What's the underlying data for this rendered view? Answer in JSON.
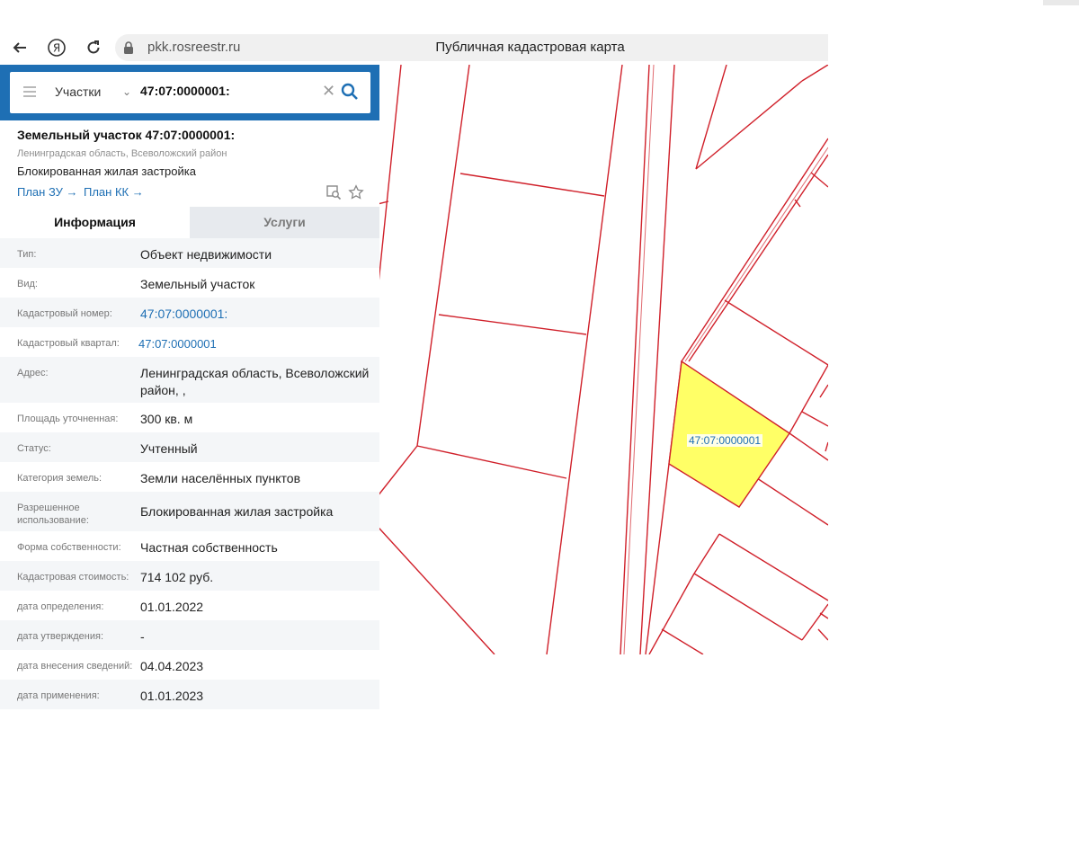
{
  "browser": {
    "url": "pkk.rosreestr.ru",
    "title": "Публичная кадастровая карта",
    "back_icon": "arrow-left-icon",
    "home_icon": "yandex-icon",
    "reload_icon": "reload-icon"
  },
  "search": {
    "type": "Участки",
    "value": "47:07:0000001:"
  },
  "object": {
    "title": "Земельный участок 47:07:0000001:",
    "region": "Ленинградская область, Всеволожский район",
    "purpose": "Блокированная жилая застройка",
    "link_plan_zu": "План ЗУ →",
    "link_plan_kk": "План КК →"
  },
  "tabs": {
    "info": "Информация",
    "services": "Услуги"
  },
  "rows": [
    {
      "label": "Тип:",
      "value": "Объект недвижимости"
    },
    {
      "label": "Вид:",
      "value": "Земельный участок"
    },
    {
      "label": "Кадастровый номер:",
      "value": "47:07:0000001:"
    },
    {
      "label": "Кадастровый квартал:",
      "value": "47:07:0000001"
    },
    {
      "label": "Адрес:",
      "value": "Ленинградская область, Всеволожский район, ,"
    },
    {
      "label": "Площадь уточненная:",
      "value": "300 кв. м"
    },
    {
      "label": "Статус:",
      "value": "Учтенный"
    },
    {
      "label": "Категория земель:",
      "value": "Земли населённых пунктов"
    },
    {
      "label": "Разрешенное использование:",
      "value": "Блокированная жилая застройка"
    },
    {
      "label": "Форма собственности:",
      "value": "Частная собственность"
    },
    {
      "label": "Кадастровая стоимость:",
      "value": "714 102 руб."
    },
    {
      "label": "дата определения:",
      "value": "01.01.2022"
    },
    {
      "label": "дата утверждения:",
      "value": "-"
    },
    {
      "label": "дата внесения сведений:",
      "value": "04.04.2023"
    },
    {
      "label": "дата применения:",
      "value": "01.01.2023"
    }
  ],
  "map": {
    "parcel_label": "47:07:0000001",
    "boundary_color": "#d0202a",
    "selected_fill": "#ffff66"
  }
}
